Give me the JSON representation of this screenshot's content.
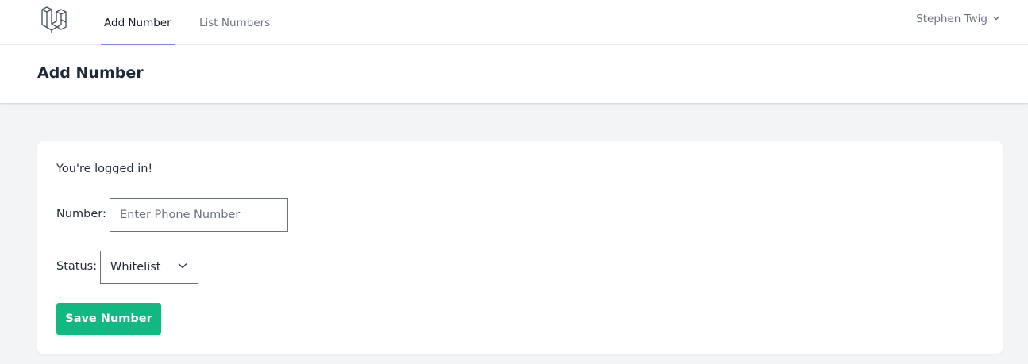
{
  "nav": {
    "logo_icon": "laravel-logo-icon",
    "links": [
      {
        "label": "Add Number",
        "active": true
      },
      {
        "label": "List Numbers",
        "active": false
      }
    ],
    "user_name": "Stephen Twig",
    "user_menu_icon": "chevron-down-icon"
  },
  "header": {
    "title": "Add Number"
  },
  "card": {
    "message": "You're logged in!",
    "number_label": "Number:",
    "number_value": "",
    "number_placeholder": "Enter Phone Number",
    "status_label": "Status:",
    "status_selected": "Whitelist",
    "status_icon": "chevron-down-icon",
    "save_label": "Save Number"
  },
  "colors": {
    "accent_underline": "#818cf8",
    "save_button": "#10b981",
    "page_background": "#f3f4f6"
  }
}
